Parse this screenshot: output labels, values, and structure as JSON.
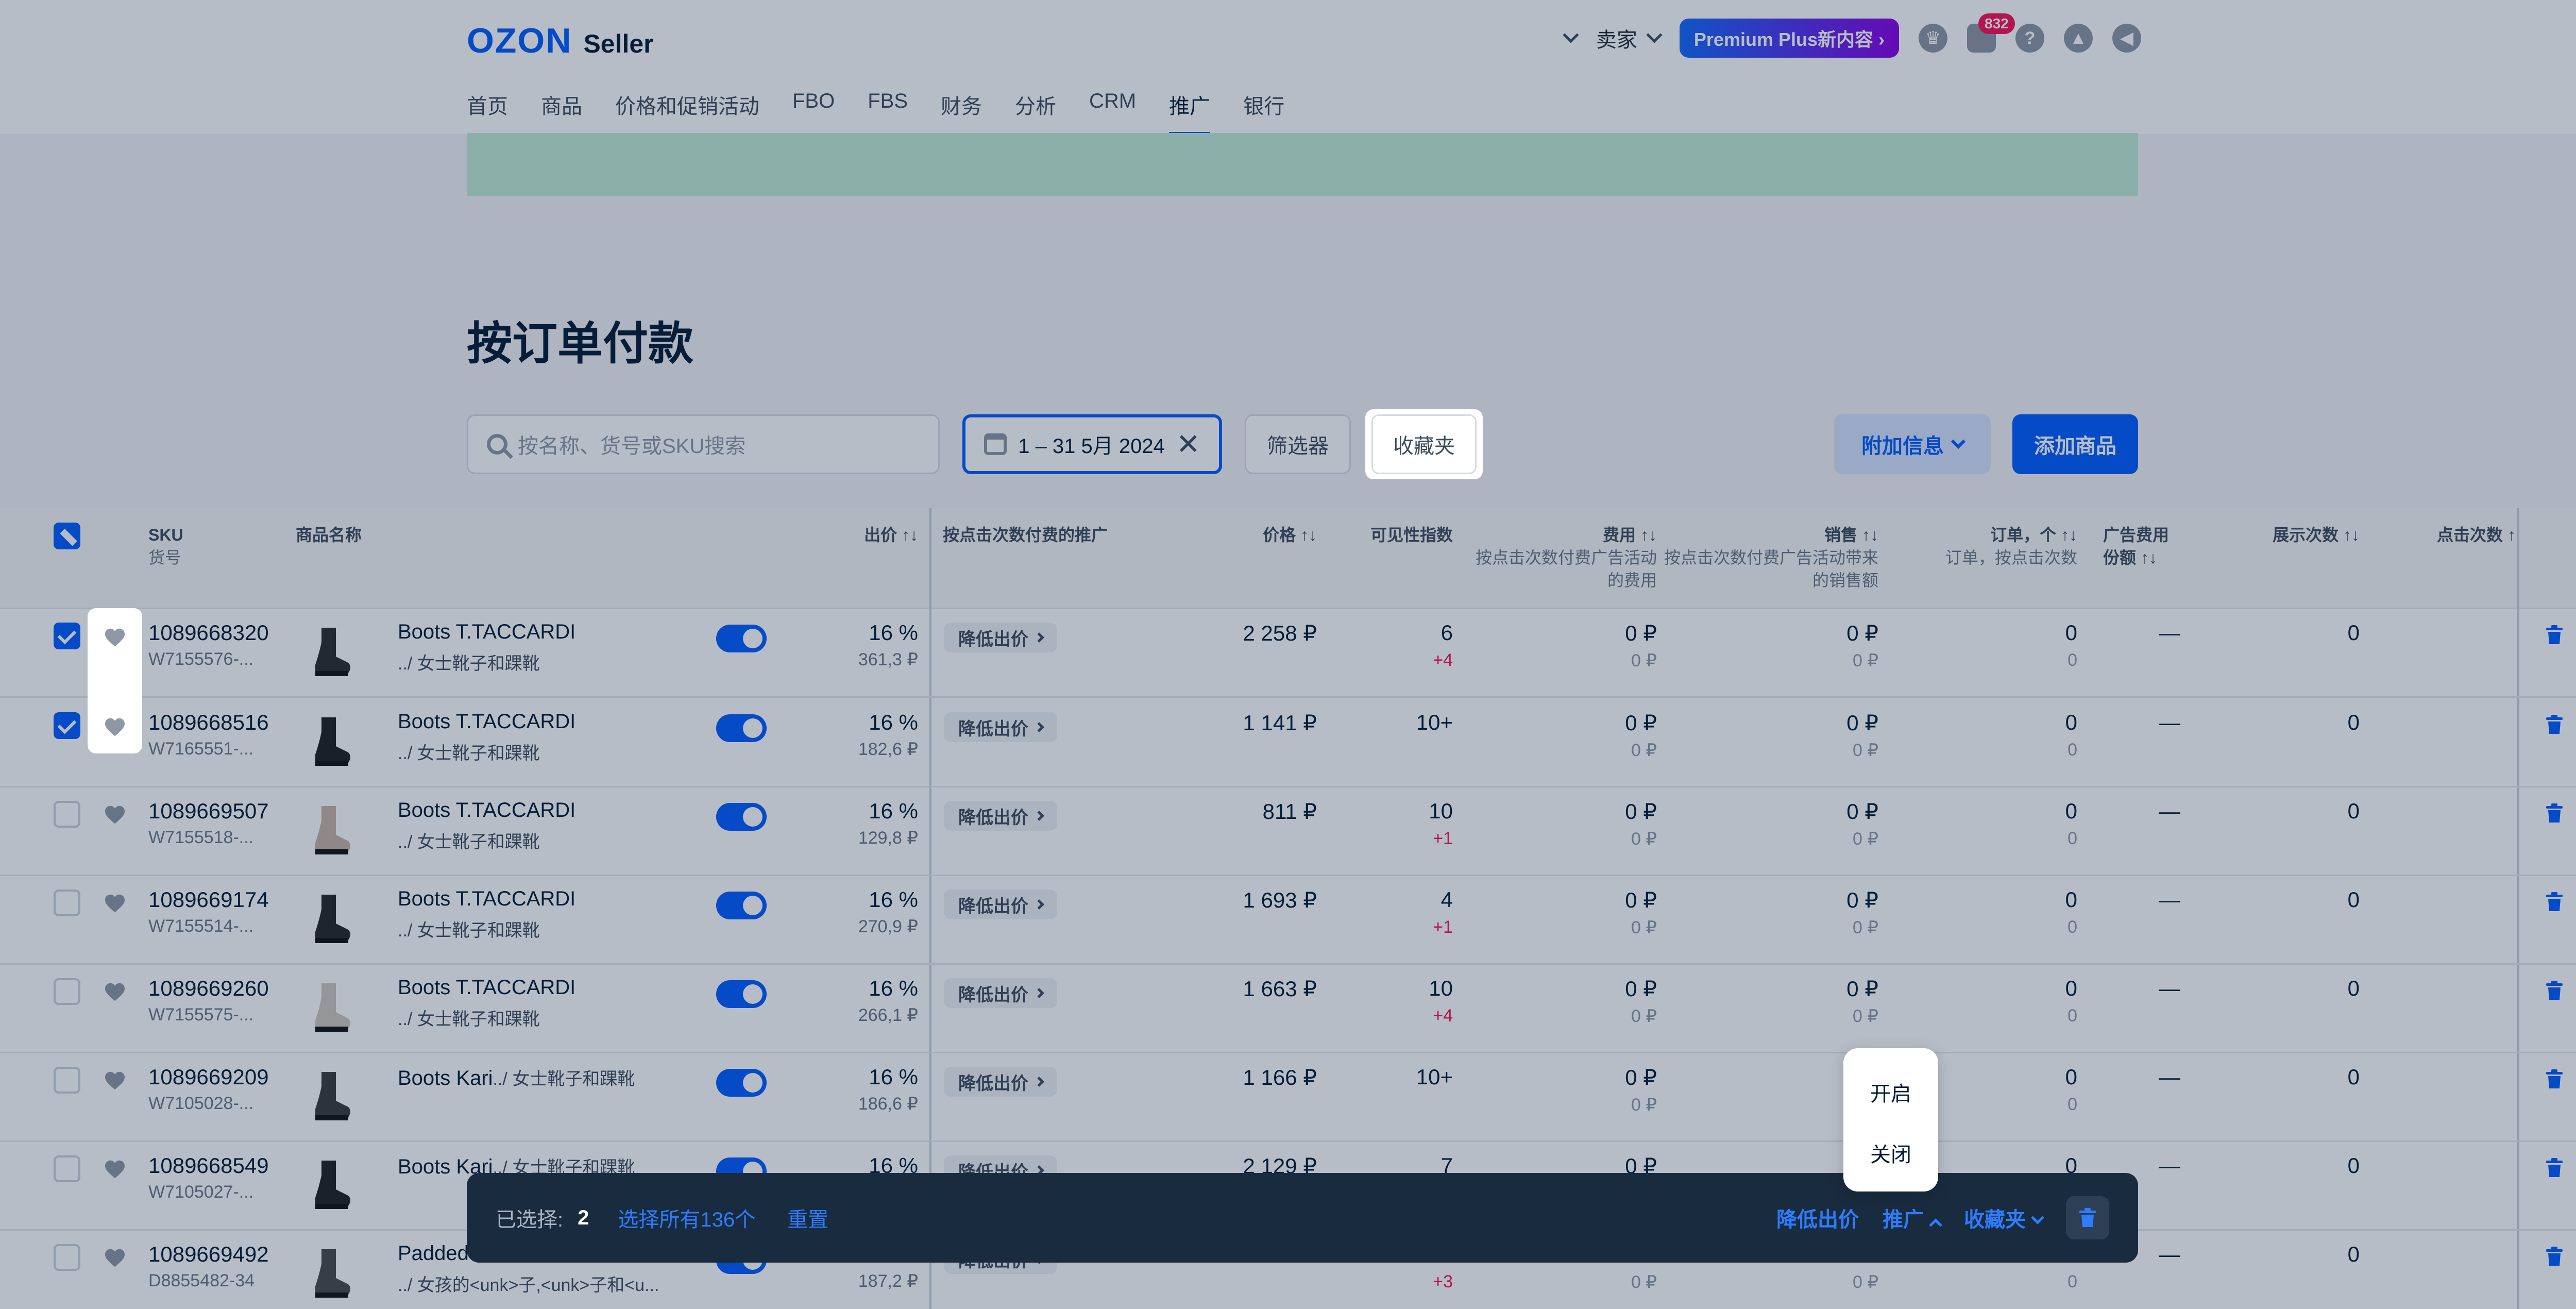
{
  "brand": {
    "logo": "OZON",
    "product": "Seller"
  },
  "header": {
    "seller_label": "卖家",
    "premium_label": "Premium Plus新内容",
    "chat_badge": "832",
    "nav": [
      {
        "label": "首页",
        "active": false
      },
      {
        "label": "商品",
        "active": false
      },
      {
        "label": "价格和促销活动",
        "active": false
      },
      {
        "label": "FBO",
        "active": false
      },
      {
        "label": "FBS",
        "active": false
      },
      {
        "label": "财务",
        "active": false
      },
      {
        "label": "分析",
        "active": false
      },
      {
        "label": "CRM",
        "active": false
      },
      {
        "label": "推广",
        "active": true
      },
      {
        "label": "银行",
        "active": false
      }
    ]
  },
  "page": {
    "title": "按订单付款"
  },
  "toolbar": {
    "search_placeholder": "按名称、货号或SKU搜索",
    "date_range": "1 – 31 5月 2024",
    "filters_label": "筛选器",
    "favorites_label": "收藏夹",
    "more_info_label": "附加信息",
    "add_product_label": "添加商品"
  },
  "table": {
    "headers": {
      "sku": "SKU",
      "article": "货号",
      "name": "商品名称",
      "bid": "出价",
      "cpc_promo": "按点击次数付费的推广",
      "price": "价格",
      "visibility": "可见性指数",
      "cost": "费用",
      "cost_sub": "按点击次数付费广告活动的费用",
      "sales": "销售",
      "sales_sub": "按点击次数付费广告活动带来的销售额",
      "orders": "订单，个",
      "orders_sub": "订单，按点击次数",
      "ad_share": "广告费用份额",
      "impressions": "展示次数",
      "clicks": "点击次数"
    },
    "lower_bid_label": "降低出价",
    "rows": [
      {
        "checked": true,
        "sku": "1089668320",
        "article": "W7155576-...",
        "name": "Boots T.TACCARDI",
        "category": "../ 女士靴子和踝靴",
        "bid_pct": "16 %",
        "bid_rub": "361,3 ₽",
        "price": "2 258 ₽",
        "visibility": "6",
        "visibility_delta": "+4",
        "cost": "0 ₽",
        "cost_sub": "0 ₽",
        "sales": "0 ₽",
        "sales_sub": "0 ₽",
        "orders": "0",
        "orders_sub": "0",
        "ad_share": "—",
        "impressions": "0"
      },
      {
        "checked": true,
        "sku": "1089668516",
        "article": "W7165551-...",
        "name": "Boots T.TACCARDI",
        "category": "../ 女士靴子和踝靴",
        "bid_pct": "16 %",
        "bid_rub": "182,6 ₽",
        "price": "1 141 ₽",
        "visibility": "10+",
        "visibility_delta": "",
        "cost": "0 ₽",
        "cost_sub": "0 ₽",
        "sales": "0 ₽",
        "sales_sub": "0 ₽",
        "orders": "0",
        "orders_sub": "0",
        "ad_share": "—",
        "impressions": "0"
      },
      {
        "checked": false,
        "sku": "1089669507",
        "article": "W7155518-...",
        "name": "Boots T.TACCARDI",
        "category": "../ 女士靴子和踝靴",
        "bid_pct": "16 %",
        "bid_rub": "129,8 ₽",
        "price": "811 ₽",
        "visibility": "10",
        "visibility_delta": "+1",
        "cost": "0 ₽",
        "cost_sub": "0 ₽",
        "sales": "0 ₽",
        "sales_sub": "0 ₽",
        "orders": "0",
        "orders_sub": "0",
        "ad_share": "—",
        "impressions": "0"
      },
      {
        "checked": false,
        "sku": "1089669174",
        "article": "W7155514-...",
        "name": "Boots T.TACCARDI",
        "category": "../ 女士靴子和踝靴",
        "bid_pct": "16 %",
        "bid_rub": "270,9 ₽",
        "price": "1 693 ₽",
        "visibility": "4",
        "visibility_delta": "+1",
        "cost": "0 ₽",
        "cost_sub": "0 ₽",
        "sales": "0 ₽",
        "sales_sub": "0 ₽",
        "orders": "0",
        "orders_sub": "0",
        "ad_share": "—",
        "impressions": "0"
      },
      {
        "checked": false,
        "sku": "1089669260",
        "article": "W7155575-...",
        "name": "Boots T.TACCARDI",
        "category": "../ 女士靴子和踝靴",
        "bid_pct": "16 %",
        "bid_rub": "266,1 ₽",
        "price": "1 663 ₽",
        "visibility": "10",
        "visibility_delta": "+4",
        "cost": "0 ₽",
        "cost_sub": "0 ₽",
        "sales": "0 ₽",
        "sales_sub": "0 ₽",
        "orders": "0",
        "orders_sub": "0",
        "ad_share": "—",
        "impressions": "0"
      },
      {
        "checked": false,
        "sku": "1089669209",
        "article": "W7105028-...",
        "name": "Boots Kari",
        "category": "../ 女士靴子和踝靴",
        "bid_pct": "16 %",
        "bid_rub": "186,6 ₽",
        "price": "1 166 ₽",
        "visibility": "10+",
        "visibility_delta": "",
        "cost": "0 ₽",
        "cost_sub": "0 ₽",
        "sales": "",
        "sales_sub": "",
        "orders": "0",
        "orders_sub": "0",
        "ad_share": "—",
        "impressions": "0"
      },
      {
        "checked": false,
        "sku": "1089668549",
        "article": "W7105027-...",
        "name": "Boots Kari",
        "category": "../ 女士靴子和踝靴",
        "bid_pct": "16 %",
        "bid_rub": "",
        "price": "2 129 ₽",
        "visibility": "7",
        "visibility_delta": "",
        "cost": "0 ₽",
        "cost_sub": "",
        "sales": "",
        "sales_sub": "",
        "orders": "0",
        "orders_sub": "",
        "ad_share": "—",
        "impressions": "0"
      },
      {
        "checked": false,
        "sku": "1089669492",
        "article": "D8855482-34",
        "name": "Padded Boots ...",
        "category": "../ 女孩的<unk>子,<unk>子和<u...",
        "bid_pct": "",
        "bid_rub": "187,2 ₽",
        "price": "",
        "visibility": "",
        "visibility_delta": "+3",
        "cost": "",
        "cost_sub": "0 ₽",
        "sales": "",
        "sales_sub": "0 ₽",
        "orders": "0",
        "orders_sub": "0",
        "ad_share": "—",
        "impressions": "0"
      }
    ]
  },
  "actionbar": {
    "selected_label": "已选择:",
    "selected_count": "2",
    "select_all_label": "选择所有136个",
    "reset_label": "重置",
    "lower_bid_label": "降低出价",
    "promote_label": "推广",
    "favorites_label": "收藏夹"
  },
  "promote_menu": {
    "items": [
      "开启",
      "关闭"
    ]
  }
}
